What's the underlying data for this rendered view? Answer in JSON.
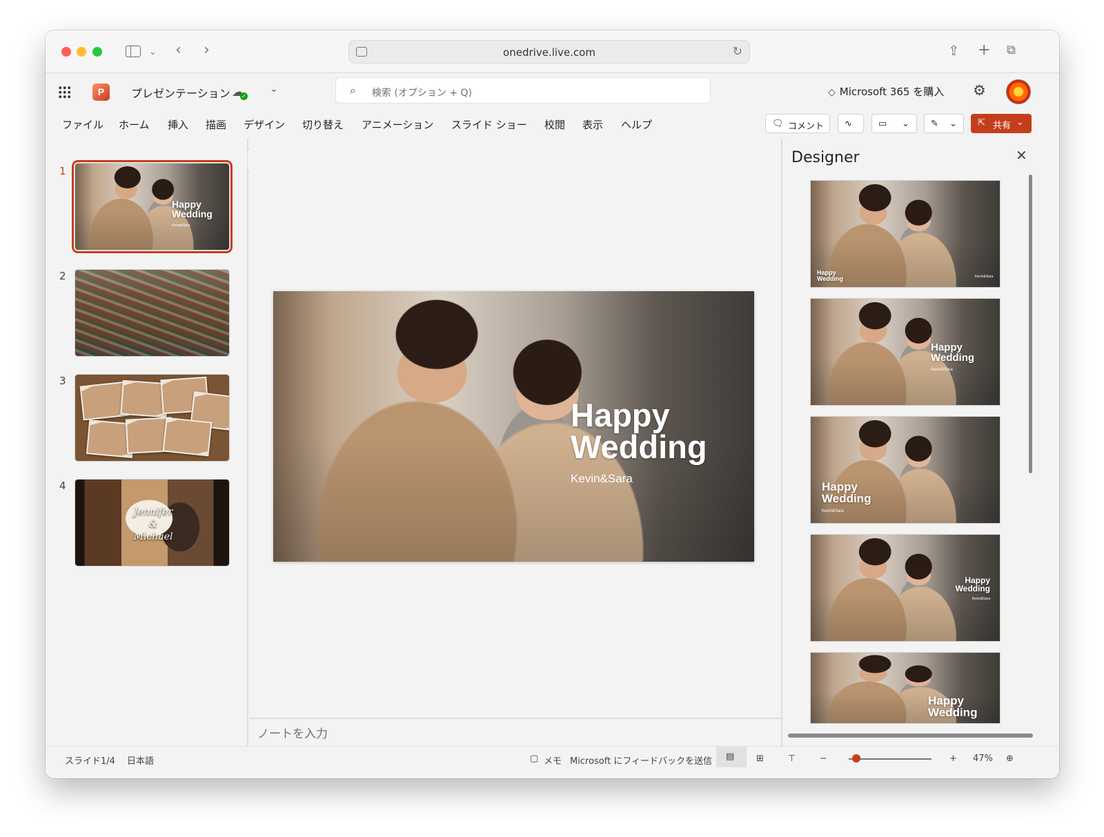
{
  "browser": {
    "url": "onedrive.live.com",
    "icons": [
      "sidebar-icon",
      "chevron-down-icon",
      "back-icon",
      "forward-icon",
      "share-icon",
      "new-tab-icon",
      "tabs-icon",
      "reload-icon"
    ]
  },
  "app": {
    "name": "PowerPoint",
    "doc_title": "プレゼンテーション",
    "search_placeholder": "検索 (オプション + Q)",
    "buy": "Microsoft 365 を購入",
    "accent": "#c43e1c"
  },
  "ribbon": {
    "tabs": [
      "ファイル",
      "ホーム",
      "挿入",
      "描画",
      "デザイン",
      "切り替え",
      "アニメーション",
      "スライド ショー",
      "校閲",
      "表示",
      "ヘルプ"
    ],
    "comment": "コメント",
    "share": "共有"
  },
  "slides": [
    {
      "number": "1",
      "title_line1": "Happy",
      "title_line2": "Wedding",
      "subtitle": "Kevin&Sara",
      "selected": true
    },
    {
      "number": "2"
    },
    {
      "number": "3"
    },
    {
      "number": "4",
      "text_line1": "Jennifer",
      "text_line2": "&",
      "text_line3": "Michael"
    }
  ],
  "main_slide": {
    "title_line1": "Happy",
    "title_line2": "Wedding",
    "subtitle": "Kevin&Sara"
  },
  "notes_placeholder": "ノートを入力",
  "designer": {
    "title": "Designer",
    "cards": [
      {
        "title_line1": "Happy",
        "title_line2": "Wedding",
        "subtitle": "Kevin&Sara"
      },
      {
        "title_line1": "Happy",
        "title_line2": "Wedding",
        "subtitle": "Kevin&Sara"
      },
      {
        "title_line1": "Happy",
        "title_line2": "Wedding",
        "subtitle": "Kevin&Sara"
      },
      {
        "title_line1": "Happy",
        "title_line2": "Wedding",
        "subtitle": "Kevin&Sara"
      },
      {
        "title_line1": "Happy",
        "title_line2": "Wedding"
      }
    ]
  },
  "status": {
    "slide_info": "スライド1/4",
    "language": "日本語",
    "notes_button": "メモ",
    "feedback": "Microsoft にフィードバックを送信",
    "zoom_minus": "−",
    "zoom_plus": "+",
    "zoom": "47%",
    "zoom_level": 0.06
  }
}
